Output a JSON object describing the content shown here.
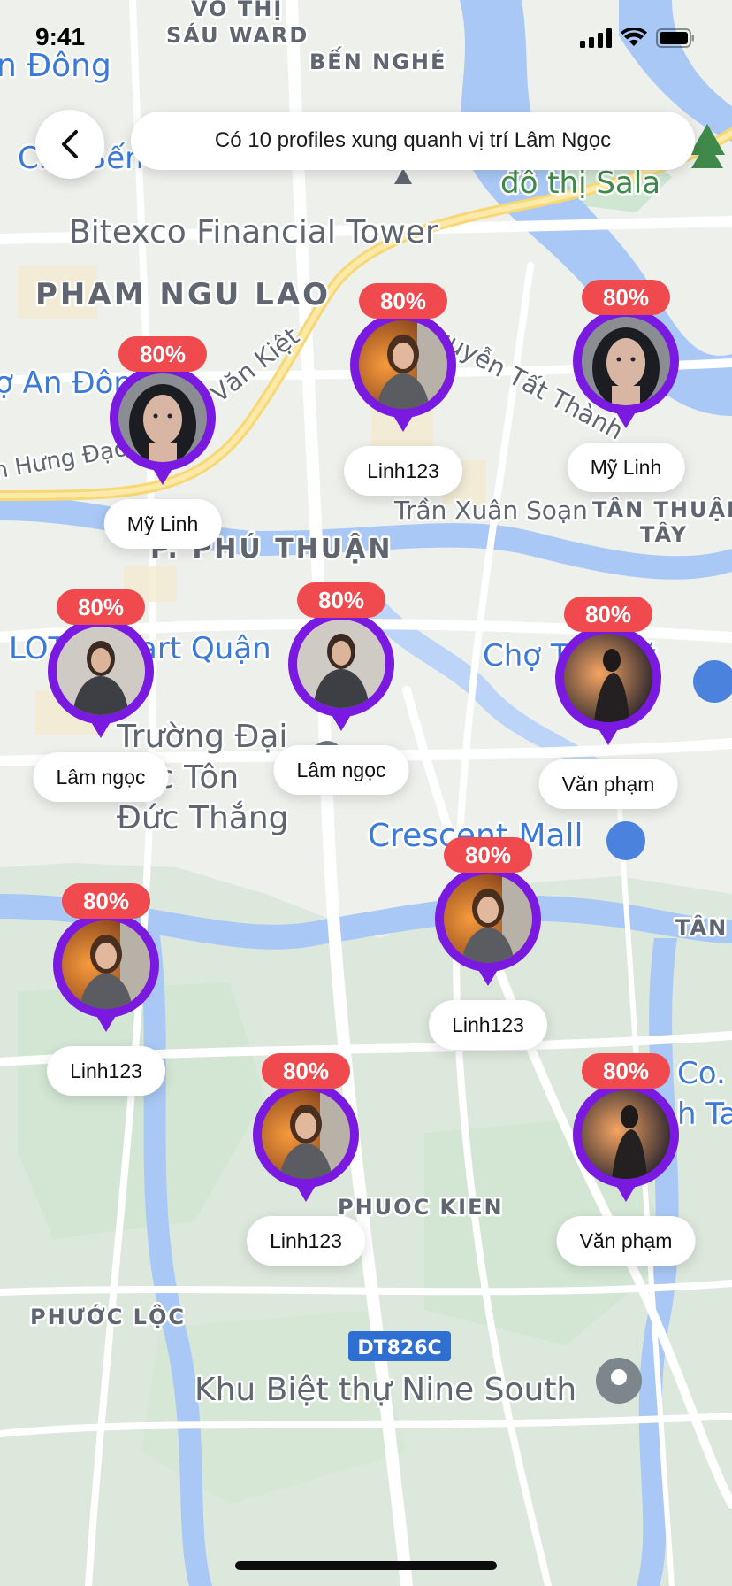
{
  "status": {
    "time": "9:41"
  },
  "header": {
    "text": "Có 10 profiles xung quanh vị trí Lâm Ngọc"
  },
  "map_labels": {
    "vo_thi": "VÕ THỊ",
    "sau_ward": "SÁU WARD",
    "ben_nghe": "BẾN NGHÉ",
    "an_dong_top": "n Đông",
    "co_ben": "Chợ Bến",
    "do_thi_sala": "đô thị Sala",
    "bitexco": "Bitexco Financial Tower",
    "pham_ngu_lao": "PHAM NGU LAO",
    "van_kiet": "Văn Kiệt",
    "nguyen_tat_thanh": "Nguyễn Tất Thành",
    "an_dong": "ợ An Đông",
    "hung_dao": "n Hưng Đạo",
    "tran_xuan_soan": "Trần Xuân Soạn",
    "tan_thuan_tay_1": "TÂN THUẬN",
    "tan_thuan_tay_2": "TÂY",
    "phu_thuan": "P. PHÚ THUẬN",
    "lotte_mart": "LOTTE Mart Quận",
    "cho_tan_my": "Chợ Tân Mỹ",
    "truong_dai_1": "Trường Đại",
    "truong_dai_2": "học Tôn",
    "truong_dai_3": "Đức Thắng",
    "crescent_mall": "Crescent Mall",
    "tan_right": "TÂN",
    "phuoc_kien": "PHUOC KIEN",
    "phuoc_loc": "PHƯỚC LỘC",
    "dt826c": "DT826C",
    "khu_biet_thu": "Khu Biệt thự Nine South",
    "co_right": "Co.",
    "h_ta": "h Ta"
  },
  "colors": {
    "accent": "#7a19e0",
    "badge": "#f04a4e",
    "water": "#a9c8f5",
    "park": "#cfe6d3",
    "road": "#ffffff",
    "highway": "#fbe29a"
  },
  "pins": [
    {
      "name": "Mỹ Linh",
      "match": "80%",
      "photo": "portrait-dark-hair-woman"
    },
    {
      "name": "Linh123",
      "match": "80%",
      "photo": "portrait-woman-blazer-orange"
    },
    {
      "name": "Mỹ Linh",
      "match": "80%",
      "photo": "portrait-dark-hair-woman"
    },
    {
      "name": "Lâm ngọc",
      "match": "80%",
      "photo": "portrait-woman-grey-blazer"
    },
    {
      "name": "Lâm ngọc",
      "match": "80%",
      "photo": "portrait-woman-grey-blazer"
    },
    {
      "name": "Văn phạm",
      "match": "80%",
      "photo": "portrait-man-silhouette-orange"
    },
    {
      "name": "Linh123",
      "match": "80%",
      "photo": "portrait-woman-blazer-orange"
    },
    {
      "name": "Linh123",
      "match": "80%",
      "photo": "portrait-woman-blazer-orange"
    },
    {
      "name": "Linh123",
      "match": "80%",
      "photo": "portrait-woman-blazer-orange"
    },
    {
      "name": "Văn phạm",
      "match": "80%",
      "photo": "portrait-man-silhouette-orange"
    }
  ]
}
